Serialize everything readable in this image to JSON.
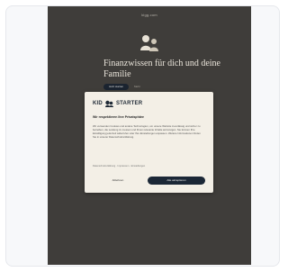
{
  "browser": {
    "url": "kigg.com"
  },
  "hero": {
    "title": "Finanzwissen für dich und deine Familie",
    "primary_button": "Jetzt starten",
    "secondary_link": "Mehr"
  },
  "cookie_modal": {
    "brand_left": "KID",
    "brand_right": "STARTER",
    "heading": "Wir respektieren Ihre Privatsphäre",
    "body": "Wir verwenden Cookies und andere Technologien, um unsere Website zuverlässig und sicher zu betreiben, die Leistung zu messen und Ihnen relevante Inhalte anzuzeigen. Sie können Ihre Einwilligung jederzeit widerrufen oder Ihre Einstellungen anpassen. Weitere Informationen finden Sie in unserer Datenschutzerklärung.",
    "footer_links": "Datenschutzerklärung · Impressum · Einstellungen",
    "reject_label": "Ablehnen",
    "accept_label": "Alle akzeptieren"
  },
  "colors": {
    "page_bg": "#ffffff",
    "card_bg": "#f7f8fa",
    "screen_bg": "#3f3d3a",
    "modal_bg": "#f3efe6",
    "accent_dark": "#1b2736"
  }
}
